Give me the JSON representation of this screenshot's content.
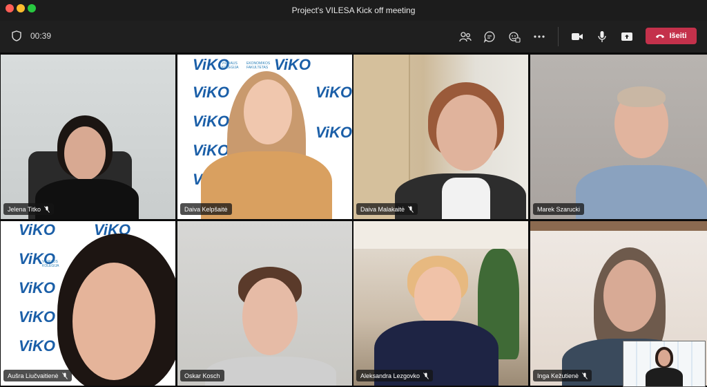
{
  "window": {
    "title": "Project's VILESA Kick off meeting"
  },
  "toolbar": {
    "timer": "00:39",
    "leave_label": "Išeiti"
  },
  "icons": [
    "shield-icon",
    "people-icon",
    "chat-icon",
    "reactions-icon",
    "more-icon",
    "camera-icon",
    "mic-icon",
    "share-icon",
    "phone-hangup-icon",
    "mic-off-icon"
  ],
  "participants": [
    {
      "name": "Jelena Titko",
      "muted": true
    },
    {
      "name": "Daiva Kelpšaitė",
      "muted": false
    },
    {
      "name": "Daiva Malakaitė",
      "muted": true
    },
    {
      "name": "Marek Szarucki",
      "muted": false
    },
    {
      "name": "Aušra Liučvaitienė",
      "muted": true
    },
    {
      "name": "Oskar Kosch",
      "muted": false
    },
    {
      "name": "Aleksandra Lezgovko",
      "muted": true
    },
    {
      "name": "Inga Kežutienė",
      "muted": true
    }
  ],
  "branding": {
    "logo": "ViKO",
    "line1": "VILNIAUS",
    "line2": "KOLEGIJA",
    "line3": "EKONOMIKOS",
    "line4": "FAKULTETAS"
  },
  "colors": {
    "leave": "#c4314b",
    "background": "#0b0b0b",
    "brand": "#1b5fa8"
  }
}
